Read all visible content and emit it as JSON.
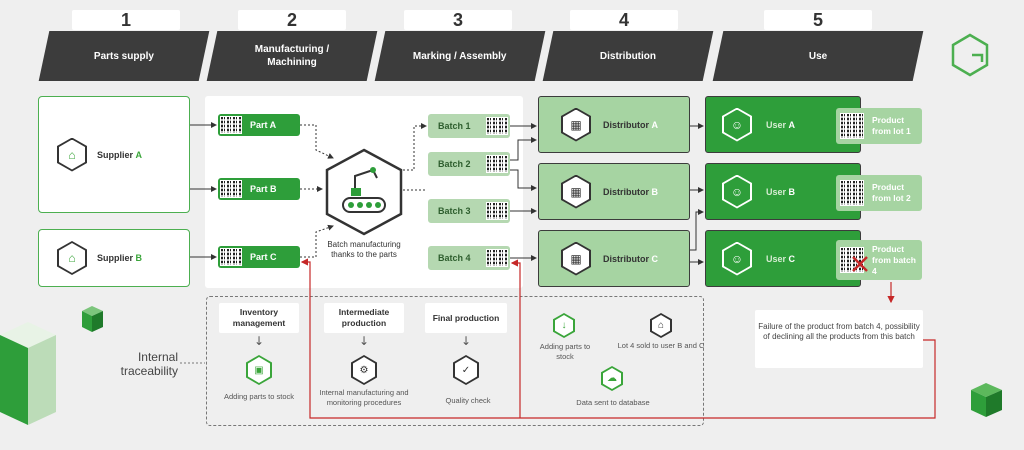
{
  "stages": [
    {
      "num": "1",
      "label": "Parts supply"
    },
    {
      "num": "2",
      "label": "Manufacturing / Machining"
    },
    {
      "num": "3",
      "label": "Marking / Assembly"
    },
    {
      "num": "4",
      "label": "Distribution"
    },
    {
      "num": "5",
      "label": "Use"
    }
  ],
  "suppliers": [
    {
      "prefix": "Supplier",
      "letter": "A",
      "icon": "factory-icon"
    },
    {
      "prefix": "Supplier",
      "letter": "B",
      "icon": "factory-icon"
    }
  ],
  "parts": [
    {
      "label": "Part A"
    },
    {
      "label": "Part B"
    },
    {
      "label": "Part C"
    }
  ],
  "machine": {
    "caption": "Batch manufacturing thanks to the parts",
    "icon": "robot-arm-conveyor-icon"
  },
  "batches": [
    {
      "label": "Batch 1"
    },
    {
      "label": "Batch 2"
    },
    {
      "label": "Batch 3"
    },
    {
      "label": "Batch 4"
    }
  ],
  "distributors": [
    {
      "prefix": "Distributor",
      "letter": "A",
      "icon": "warehouse-icon"
    },
    {
      "prefix": "Distributor",
      "letter": "B",
      "icon": "warehouse-icon"
    },
    {
      "prefix": "Distributor",
      "letter": "C",
      "icon": "warehouse-icon"
    }
  ],
  "users": [
    {
      "prefix": "User",
      "letter": "A",
      "icon": "user-icon"
    },
    {
      "prefix": "User",
      "letter": "B",
      "icon": "user-icon"
    },
    {
      "prefix": "User",
      "letter": "C",
      "icon": "user-icon"
    }
  ],
  "products": [
    {
      "line1": "Product",
      "line2": "from lot 1"
    },
    {
      "line1": "Product",
      "line2": "from lot 2"
    },
    {
      "line1": "Product",
      "line2": "from batch 4"
    }
  ],
  "failure": {
    "text": "Failure of the product from batch 4, possibility of declining all the products from this batch"
  },
  "internal": {
    "label": "Internal traceability",
    "steps": [
      {
        "head": "Inventory management",
        "caption": "Adding parts to stock",
        "icon": "stock-icon"
      },
      {
        "head": "Intermediate production",
        "caption": "Internal manufacturing and monitoring procedures",
        "icon": "gear-check-icon"
      },
      {
        "head": "Final production",
        "caption": "Quality check",
        "icon": "clipboard-check-icon"
      }
    ],
    "distribution": [
      {
        "caption": "Adding parts to stock",
        "icon": "download-icon"
      },
      {
        "caption": "Lot 4 sold to user B and C",
        "icon": "tag-icon"
      },
      {
        "caption": "Data sent to database",
        "icon": "cloud-icon"
      }
    ]
  },
  "colors": {
    "accent": "#2e9e3a",
    "light_green": "#a6d4a2",
    "dark": "#3c3c3c",
    "alert": "#c62828"
  }
}
